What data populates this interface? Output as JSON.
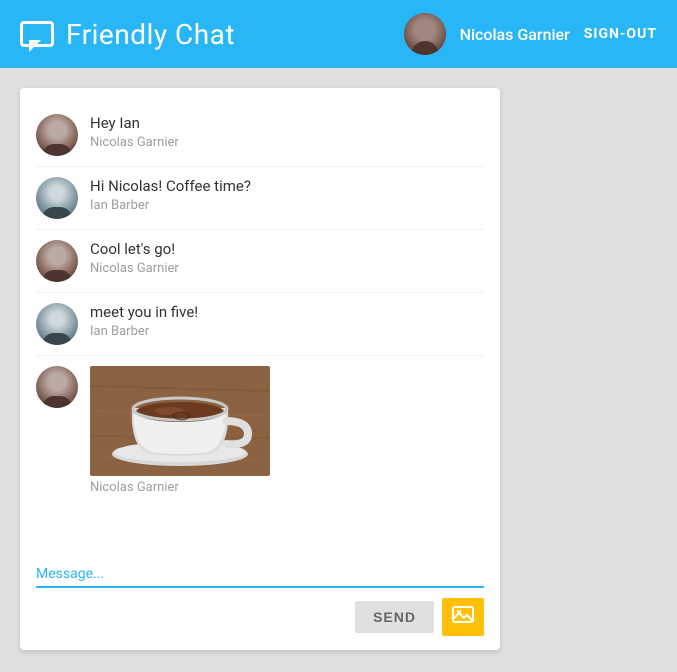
{
  "header": {
    "title": "Friendly Chat",
    "user_name": "Nicolas Garnier",
    "sign_out_label": "SIGN-OUT"
  },
  "chat": {
    "messages": [
      {
        "id": 1,
        "text": "Hey Ian",
        "sender": "Nicolas Garnier",
        "avatar_type": "nicolas"
      },
      {
        "id": 2,
        "text": "Hi Nicolas! Coffee time?",
        "sender": "Ian Barber",
        "avatar_type": "ian"
      },
      {
        "id": 3,
        "text": "Cool let's go!",
        "sender": "Nicolas Garnier",
        "avatar_type": "nicolas"
      },
      {
        "id": 4,
        "text": "meet you in five!",
        "sender": "Ian Barber",
        "avatar_type": "ian"
      },
      {
        "id": 5,
        "text": "",
        "sender": "Nicolas Garnier",
        "avatar_type": "nicolas",
        "has_image": true
      }
    ],
    "input_placeholder": "Message...",
    "send_label": "SEND"
  }
}
